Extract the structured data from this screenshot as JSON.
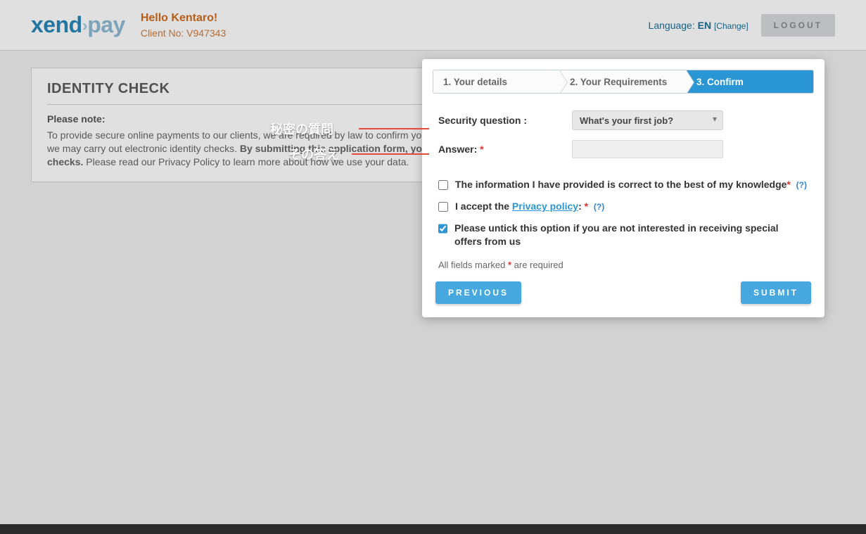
{
  "header": {
    "logo_part1": "xend",
    "logo_part2": "pay",
    "hello": "Hello Kentaro!",
    "client_no": "Client No: V947343",
    "language_label": "Language:",
    "language_value": "EN",
    "change": "[Change]",
    "logout": "LOGOUT"
  },
  "identity": {
    "title": "IDENTITY CHECK",
    "please_note": "Please note:",
    "body_1": "To provide secure online payments to our clients, we are required by law to confirm your identity and check your address. To verify your identity we may carry out electronic identity checks. ",
    "body_bold": "By submitting this application form, you are giving us explicit authorisation to conduct such checks.",
    "body_2": " Please read our Privacy Policy to learn more about how we use your data."
  },
  "modal": {
    "steps": [
      "1. Your details",
      "2. Your Requirements",
      "3. Confirm"
    ],
    "active_step": 3,
    "security_question_label": "Security question :",
    "security_question_value": "What's your first job?",
    "answer_label": "Answer:",
    "check1": "The information I have provided is correct to the best of my knowledge",
    "check2_pre": "I accept the ",
    "check2_link": "Privacy policy",
    "check2_post": ":",
    "check3": "Please untick this option if you are not interested in receiving special offers from us",
    "help": "(?)",
    "required_note_pre": "All fields marked ",
    "required_note_post": " are required",
    "previous": "PREVIOUS",
    "submit": "SUBMIT"
  },
  "annotations": {
    "security_question": "秘密の質問",
    "answer": "その答え"
  }
}
